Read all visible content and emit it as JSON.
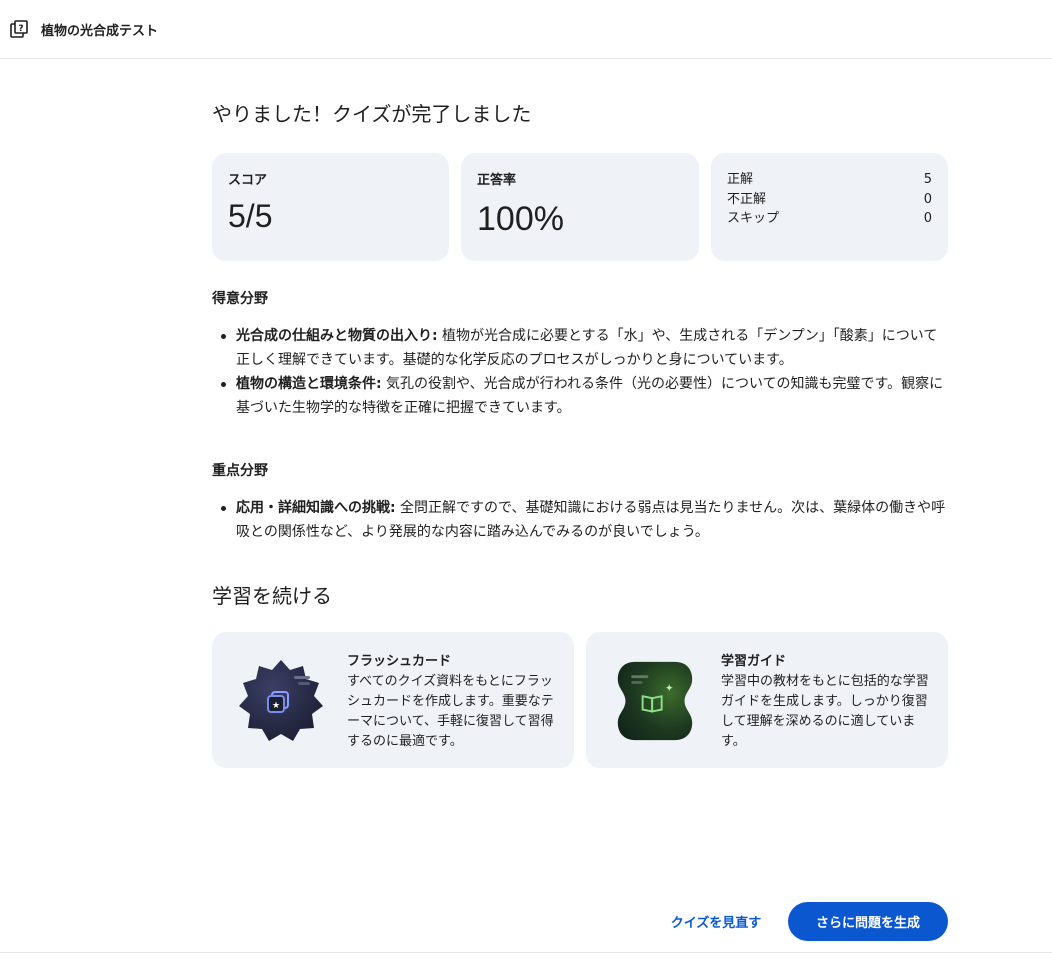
{
  "header": {
    "title": "植物の光合成テスト",
    "icon": "quiz-icon"
  },
  "result": {
    "headline": "やりました！クイズが完了しました",
    "score_label": "スコア",
    "score_value": "5/5",
    "accuracy_label": "正答率",
    "accuracy_value": "100%",
    "breakdown": [
      {
        "label": "正解",
        "value": "5"
      },
      {
        "label": "不正解",
        "value": "0"
      },
      {
        "label": "スキップ",
        "value": "0"
      }
    ]
  },
  "strengths": {
    "title": "得意分野",
    "items": [
      {
        "bold": "光合成の仕組みと物質の出入り:",
        "text": " 植物が光合成に必要とする「水」や、生成される「デンプン」「酸素」について正しく理解できています。基礎的な化学反応のプロセスがしっかりと身についています。"
      },
      {
        "bold": "植物の構造と環境条件:",
        "text": " 気孔の役割や、光合成が行われる条件（光の必要性）についての知識も完璧です。観察に基づいた生物学的な特徴を正確に把握できています。"
      }
    ]
  },
  "focus": {
    "title": "重点分野",
    "items": [
      {
        "bold": "応用・詳細知識への挑戦:",
        "text": " 全問正解ですので、基礎知識における弱点は見当たりません。次は、葉緑体の働きや呼吸との関係性など、より発展的な内容に踏み込んでみるのが良いでしょう。"
      }
    ]
  },
  "continue": {
    "title": "学習を続ける",
    "cards": [
      {
        "title": "フラッシュカード",
        "desc": "すべてのクイズ資料をもとにフラッシュカードを作成します。重要なテーマについて、手軽に復習して習得するのに最適です。",
        "icon": "flashcards-icon"
      },
      {
        "title": "学習ガイド",
        "desc": "学習中の教材をもとに包括的な学習ガイドを生成します。しっかり復習して理解を深めるのに適しています。",
        "icon": "study-guide-icon"
      }
    ]
  },
  "actions": {
    "review_label": "クイズを見直す",
    "generate_label": "さらに問題を生成"
  },
  "colors": {
    "accent": "#0b57d0",
    "card_bg": "#eff2f7"
  }
}
